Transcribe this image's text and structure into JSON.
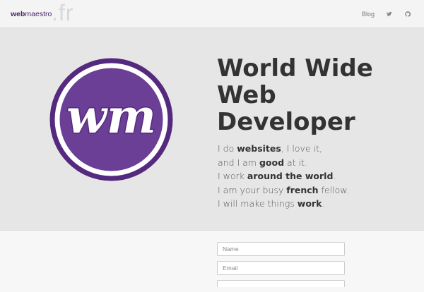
{
  "nav": {
    "brand_bold": "web",
    "brand_rest": "maestro",
    "brand_tld": ".fr",
    "links": [
      {
        "label": "Blog"
      }
    ],
    "icons": [
      "twitter-icon",
      "github-icon"
    ]
  },
  "hero": {
    "logo_text": "wm",
    "title_lines": [
      "World Wide",
      "Web",
      "Developer"
    ],
    "tagline": [
      {
        "before": "I do ",
        "bold": "websites",
        "after": ", I love it,"
      },
      {
        "before": "and I am ",
        "bold": "good",
        "after": " at it."
      },
      {
        "before": "I work ",
        "bold": "around the world",
        "after": "."
      },
      {
        "before": "I am your busy ",
        "bold": "french",
        "after": " fellow."
      },
      {
        "before": "I will make things ",
        "bold": "work",
        "after": "."
      }
    ]
  },
  "form": {
    "name_placeholder": "Name",
    "email_placeholder": "Email",
    "name_value": "",
    "email_value": ""
  },
  "colors": {
    "brand_purple": "#4a2669",
    "logo_purple": "#6b3f96",
    "logo_ring": "#55297e",
    "hero_bg": "#e6e6e6",
    "page_bg": "#f7f7f7"
  }
}
